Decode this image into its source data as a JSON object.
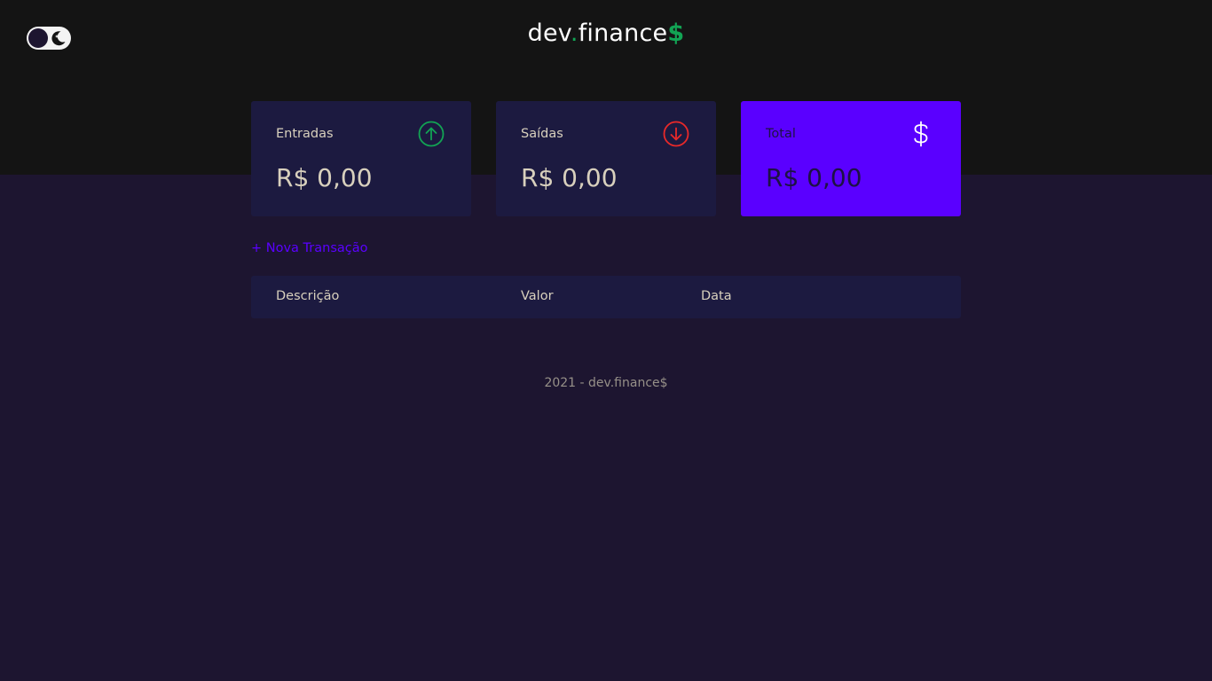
{
  "header": {
    "logo": {
      "main": "dev",
      "dot": ".",
      "rest": "finance",
      "suffix": "$"
    },
    "theme_toggle": {
      "icon": "moon-icon"
    }
  },
  "cards": [
    {
      "id": "income",
      "title": "Entradas",
      "amount": "R$ 0,00",
      "icon": "arrow-up-circle-icon",
      "icon_color": "#12a454"
    },
    {
      "id": "expense",
      "title": "Saídas",
      "amount": "R$ 0,00",
      "icon": "arrow-down-circle-icon",
      "icon_color": "#e92929"
    },
    {
      "id": "total",
      "title": "Total",
      "amount": "R$ 0,00",
      "icon": "dollar-icon",
      "icon_color": "#ffffff"
    }
  ],
  "new_transaction_label": "+ Nova Transação",
  "table": {
    "columns": [
      "Descrição",
      "Valor",
      "Data"
    ],
    "rows": []
  },
  "footer": {
    "text": "2021 - dev.finance$"
  },
  "colors": {
    "background": "#1d1530",
    "header_bg": "#141414",
    "card_bg": "#1c1a40",
    "accent": "#5a00ff",
    "green": "#12a454",
    "red": "#e92929"
  }
}
